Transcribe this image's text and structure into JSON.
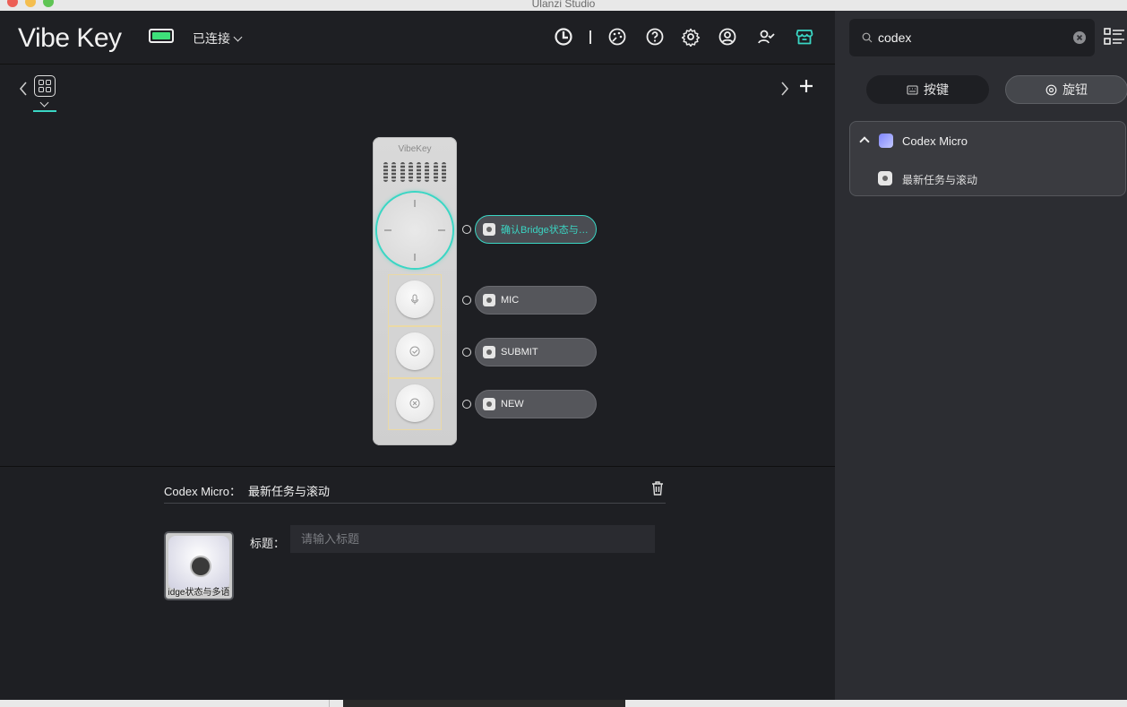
{
  "window": {
    "title": "Ulanzi Studio"
  },
  "header": {
    "logo": "Vibe Key",
    "connection": "已连接",
    "colors": {
      "accent": "#3ad6c4",
      "battery": "#3ee07a"
    }
  },
  "device": {
    "brand": "VibeKey",
    "slots": [
      {
        "label": "确认Bridge状态与…",
        "active": true
      },
      {
        "label": "MIC",
        "active": false
      },
      {
        "label": "SUBMIT",
        "active": false
      },
      {
        "label": "NEW",
        "active": false
      }
    ]
  },
  "detail": {
    "plugin": "Codex Micro：",
    "action": "最新任务与滚动",
    "thumb_caption": "idge状态与多语",
    "title_label": "标题：",
    "title_placeholder": "请输入标题",
    "title_value": ""
  },
  "sidebar": {
    "search_value": "codex",
    "tabs": [
      {
        "label": "按键",
        "icon": "keyboard-icon",
        "active": false
      },
      {
        "label": "旋钮",
        "icon": "knob-icon",
        "active": true
      }
    ],
    "plugin": {
      "name": "Codex Micro",
      "action": "最新任务与滚动"
    }
  }
}
